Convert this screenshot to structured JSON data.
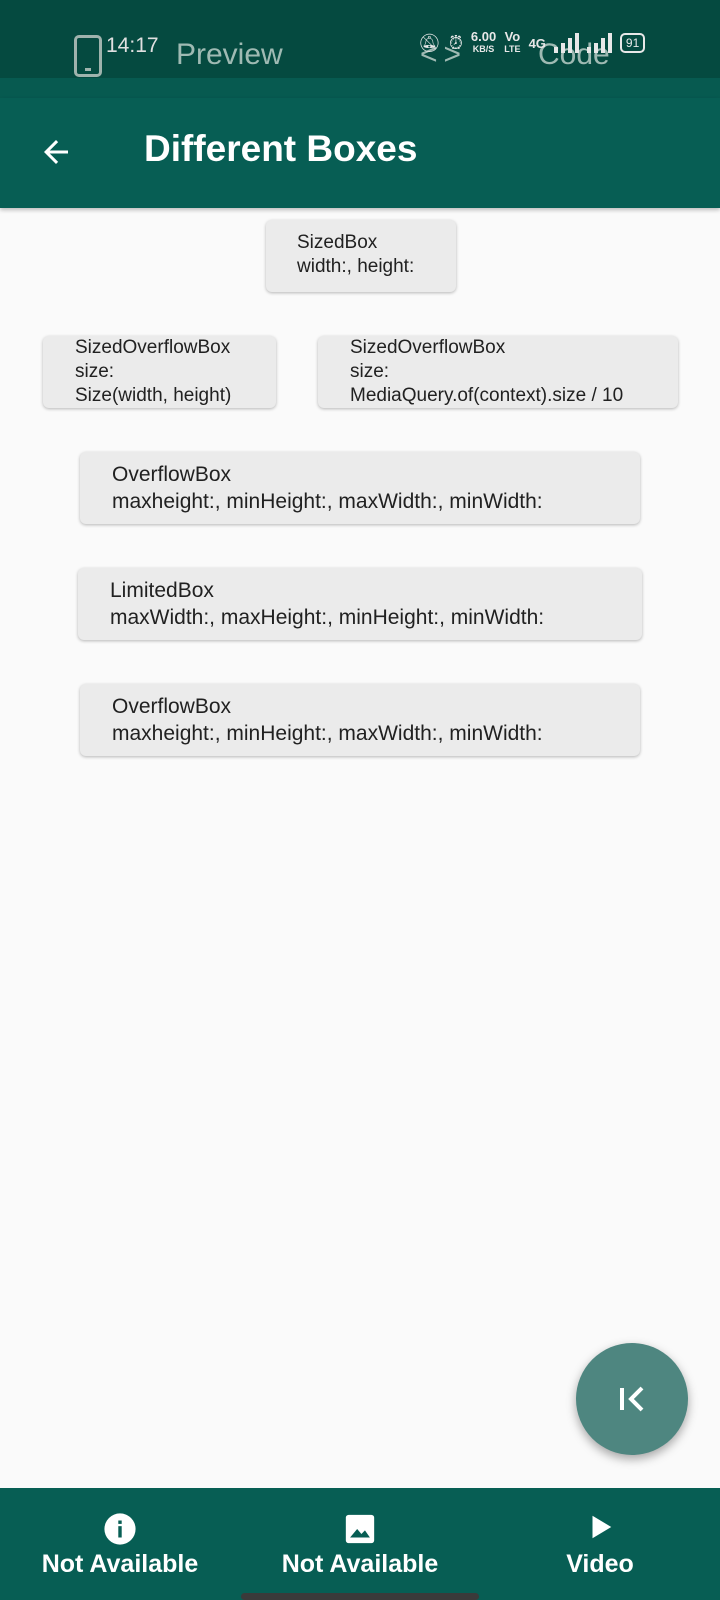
{
  "status_bar": {
    "time": "14:17",
    "preview_tab": "Preview",
    "code_tab": "Code",
    "speed_value": "6.00",
    "speed_unit": "KB/S",
    "network_label": "4G",
    "battery": "91"
  },
  "app_bar": {
    "title": "Different Boxes"
  },
  "boxes": [
    {
      "lines": [
        "SizedBox",
        "width:, height:"
      ]
    },
    {
      "lines": [
        "SizedOverflowBox",
        "size:",
        "Size(width, height)"
      ]
    },
    {
      "lines": [
        "SizedOverflowBox",
        "size:",
        "MediaQuery.of(context).size / 10"
      ]
    },
    {
      "lines": [
        "OverflowBox",
        "maxheight:, minHeight:, maxWidth:, minWidth:"
      ]
    },
    {
      "lines": [
        "LimitedBox",
        "maxWidth:, maxHeight:, minHeight:, minWidth:"
      ]
    },
    {
      "lines": [
        "OverflowBox",
        "maxheight:, minHeight:, maxWidth:, minWidth:"
      ]
    }
  ],
  "bottom_nav": {
    "items": [
      {
        "label": "Not Available",
        "icon": "info-icon"
      },
      {
        "label": "Not Available",
        "icon": "image-icon"
      },
      {
        "label": "Video",
        "icon": "play-icon"
      }
    ]
  },
  "colors": {
    "primary": "#075e54",
    "status_bar": "#054a40",
    "fab": "#4e8680",
    "box": "#ebebeb"
  }
}
